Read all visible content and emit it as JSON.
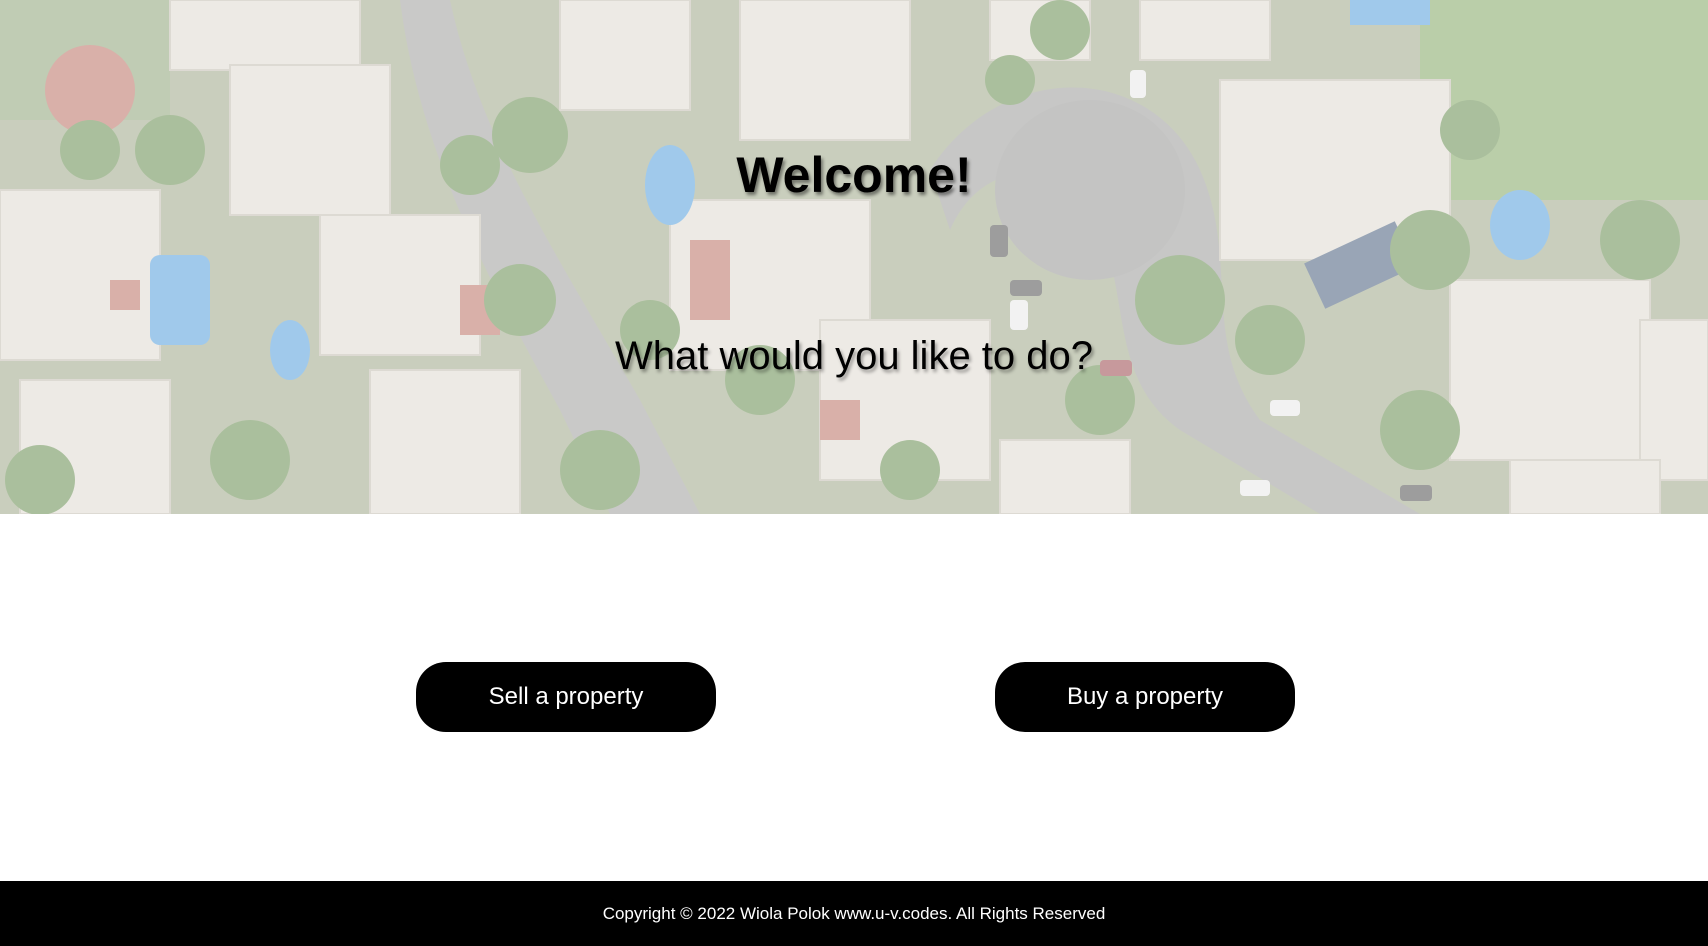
{
  "hero": {
    "title": "Welcome!",
    "subtitle": "What would you like to do?"
  },
  "actions": {
    "sell_label": "Sell a property",
    "buy_label": "Buy a property"
  },
  "footer": {
    "copyright": "Copyright © 2022 Wiola Polok www.u-v.codes. All Rights Reserved"
  },
  "colors": {
    "button_bg": "#000000",
    "button_text": "#ffffff",
    "footer_bg": "#000000",
    "page_bg": "#ffffff"
  }
}
